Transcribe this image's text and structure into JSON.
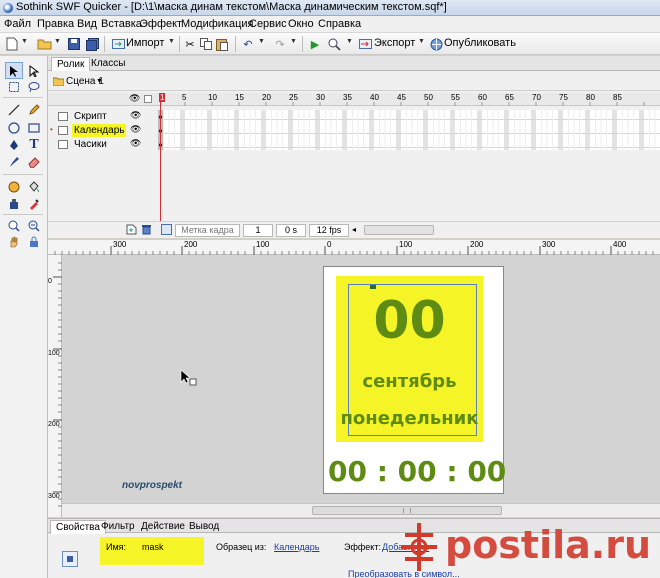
{
  "window": {
    "title": "Sothink SWF Quicker - [D:\\1\\маска динам текстом\\Маска динамическим текстом.sqf*]"
  },
  "menu": [
    "Файл",
    "Правка",
    "Вид",
    "Вставка",
    "Эффект",
    "Модификация",
    "Сервис",
    "Окно",
    "Справка"
  ],
  "toolbar": {
    "import_label": "Импорт",
    "export_label": "Экспорт",
    "publish_label": "Опубликовать"
  },
  "timeline": {
    "tabs": [
      "Ролик",
      "Классы"
    ],
    "scene_label": "Сцена 1",
    "frame_numbers": [
      "1",
      "5",
      "10",
      "15",
      "20",
      "25",
      "30",
      "35",
      "40",
      "45",
      "50",
      "55",
      "60",
      "65",
      "70",
      "75",
      "80",
      "85"
    ],
    "layers": [
      {
        "name": "Скрипт",
        "highlighted": false
      },
      {
        "name": "Календарь",
        "highlighted": true
      },
      {
        "name": "Часики",
        "highlighted": false
      }
    ],
    "status": {
      "frame_label_placeholder": "Метка кадра",
      "current_frame": "1",
      "time": "0 s",
      "fps": "12 fps"
    }
  },
  "ruler": {
    "h_marks": [
      "300",
      "200",
      "100",
      "0",
      "100",
      "200",
      "300",
      "400"
    ],
    "v_marks": [
      "0",
      "100",
      "200",
      "300"
    ]
  },
  "stage": {
    "canvas": {
      "day_number": "00",
      "month": "сентябрь",
      "weekday": "понедельник",
      "clock": "00 : 00 : 00"
    },
    "watermark": "novprospekt"
  },
  "properties": {
    "tabs": [
      "Свойства",
      "Фильтр",
      "Действие",
      "Вывод"
    ],
    "name_label": "Имя:",
    "name_value": "mask",
    "sample_label": "Образец из:",
    "sample_link": "Календарь",
    "effect_label": "Эффект:",
    "effect_link": "Добавить...",
    "convert_link": "Преобразовать в символ..."
  },
  "overlay": {
    "site_watermark": "postila.ru"
  },
  "colors": {
    "highlight_yellow": "#f4f426",
    "dark_green_text": "#5e8b13",
    "link_blue": "#1a3ea8",
    "playhead_red": "#d23030",
    "postila_red": "#d23b2c"
  }
}
